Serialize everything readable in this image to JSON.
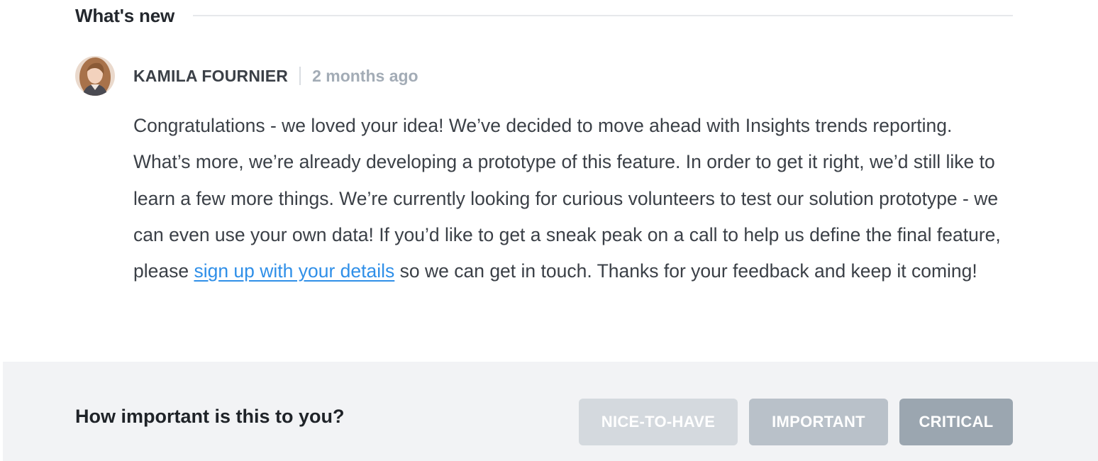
{
  "section": {
    "title": "What's new"
  },
  "post": {
    "author": "KAMILA FOURNIER",
    "timestamp": "2 months ago",
    "body_before_link": "Congratulations - we loved your idea! We’ve decided to move ahead with Insights trends reporting. What’s more, we’re already developing a prototype of this feature. In order to get it right, we’d still like to learn a few more things. We’re currently looking for curious volunteers to test our solution prototype - we can even use your own data! If you’d like to get a sneak peak on a call to help us define the final feature, please ",
    "link_text": "sign up with your details",
    "body_after_link": " so we can get in touch. Thanks for your feedback and keep it coming!"
  },
  "rating": {
    "question": "How important is this to you?",
    "options": [
      "NICE-TO-HAVE",
      "IMPORTANT",
      "CRITICAL"
    ]
  },
  "colors": {
    "link": "#2f8fe8",
    "nice_to_have": "#d4d9de",
    "important": "#b9c1c9",
    "critical": "#9ba6b0",
    "rating_background": "#f2f3f5"
  }
}
